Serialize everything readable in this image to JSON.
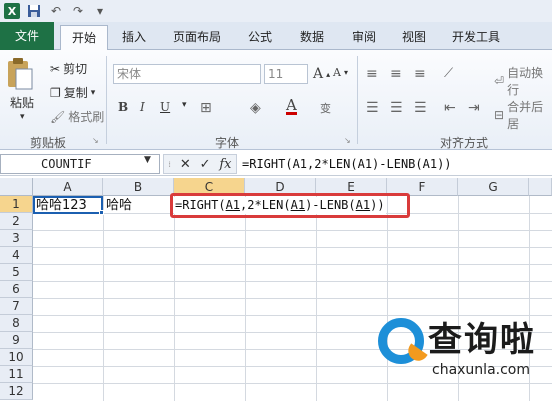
{
  "qat": {
    "undo": "↶",
    "redo": "↷"
  },
  "tabs": {
    "file": "文件",
    "items": [
      "开始",
      "插入",
      "页面布局",
      "公式",
      "数据",
      "审阅",
      "视图",
      "开发工具"
    ]
  },
  "ribbon": {
    "clipboard": {
      "paste": "粘贴",
      "cut": "剪切",
      "copy": "复制",
      "format_painter": "格式刷",
      "label": "剪贴板"
    },
    "font": {
      "name": "宋体",
      "size": "11",
      "label": "字体"
    },
    "align": {
      "wrap": "自动换行",
      "merge": "合并后居",
      "label": "对齐方式"
    }
  },
  "formula_bar": {
    "name_box": "COUNTIF",
    "cancel": "✕",
    "enter": "✓",
    "fx": "fx",
    "formula": "=RIGHT(A1,2*LEN(A1)-LENB(A1))"
  },
  "grid": {
    "columns": [
      "A",
      "B",
      "C",
      "D",
      "E",
      "F",
      "G"
    ],
    "rows": [
      "1",
      "2",
      "3",
      "4",
      "5",
      "6",
      "7",
      "8",
      "9",
      "10",
      "11",
      "12"
    ],
    "cells": {
      "A1": "哈哈123",
      "B1": "哈哈"
    },
    "edit_formula_parts": [
      "=RIGHT(",
      "A1",
      ",2*LEN(",
      "A1",
      ")-LENB(",
      "A1",
      "))"
    ]
  },
  "watermark": {
    "text": "查询啦",
    "url": "chaxunla.com"
  },
  "colors": {
    "file_tab": "#1e7145",
    "selection": "#1b5fb0",
    "highlight": "#d93b3b",
    "logo_blue": "#1d8fd8",
    "logo_orange": "#f39a1e"
  }
}
